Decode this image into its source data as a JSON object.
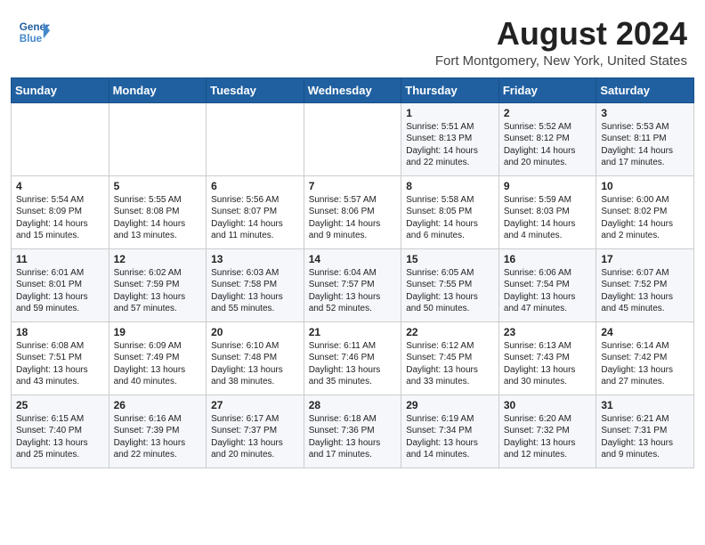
{
  "header": {
    "logo_line1": "General",
    "logo_line2": "Blue",
    "month_year": "August 2024",
    "location": "Fort Montgomery, New York, United States"
  },
  "weekdays": [
    "Sunday",
    "Monday",
    "Tuesday",
    "Wednesday",
    "Thursday",
    "Friday",
    "Saturday"
  ],
  "weeks": [
    [
      {
        "day": "",
        "info": ""
      },
      {
        "day": "",
        "info": ""
      },
      {
        "day": "",
        "info": ""
      },
      {
        "day": "",
        "info": ""
      },
      {
        "day": "1",
        "info": "Sunrise: 5:51 AM\nSunset: 8:13 PM\nDaylight: 14 hours\nand 22 minutes."
      },
      {
        "day": "2",
        "info": "Sunrise: 5:52 AM\nSunset: 8:12 PM\nDaylight: 14 hours\nand 20 minutes."
      },
      {
        "day": "3",
        "info": "Sunrise: 5:53 AM\nSunset: 8:11 PM\nDaylight: 14 hours\nand 17 minutes."
      }
    ],
    [
      {
        "day": "4",
        "info": "Sunrise: 5:54 AM\nSunset: 8:09 PM\nDaylight: 14 hours\nand 15 minutes."
      },
      {
        "day": "5",
        "info": "Sunrise: 5:55 AM\nSunset: 8:08 PM\nDaylight: 14 hours\nand 13 minutes."
      },
      {
        "day": "6",
        "info": "Sunrise: 5:56 AM\nSunset: 8:07 PM\nDaylight: 14 hours\nand 11 minutes."
      },
      {
        "day": "7",
        "info": "Sunrise: 5:57 AM\nSunset: 8:06 PM\nDaylight: 14 hours\nand 9 minutes."
      },
      {
        "day": "8",
        "info": "Sunrise: 5:58 AM\nSunset: 8:05 PM\nDaylight: 14 hours\nand 6 minutes."
      },
      {
        "day": "9",
        "info": "Sunrise: 5:59 AM\nSunset: 8:03 PM\nDaylight: 14 hours\nand 4 minutes."
      },
      {
        "day": "10",
        "info": "Sunrise: 6:00 AM\nSunset: 8:02 PM\nDaylight: 14 hours\nand 2 minutes."
      }
    ],
    [
      {
        "day": "11",
        "info": "Sunrise: 6:01 AM\nSunset: 8:01 PM\nDaylight: 13 hours\nand 59 minutes."
      },
      {
        "day": "12",
        "info": "Sunrise: 6:02 AM\nSunset: 7:59 PM\nDaylight: 13 hours\nand 57 minutes."
      },
      {
        "day": "13",
        "info": "Sunrise: 6:03 AM\nSunset: 7:58 PM\nDaylight: 13 hours\nand 55 minutes."
      },
      {
        "day": "14",
        "info": "Sunrise: 6:04 AM\nSunset: 7:57 PM\nDaylight: 13 hours\nand 52 minutes."
      },
      {
        "day": "15",
        "info": "Sunrise: 6:05 AM\nSunset: 7:55 PM\nDaylight: 13 hours\nand 50 minutes."
      },
      {
        "day": "16",
        "info": "Sunrise: 6:06 AM\nSunset: 7:54 PM\nDaylight: 13 hours\nand 47 minutes."
      },
      {
        "day": "17",
        "info": "Sunrise: 6:07 AM\nSunset: 7:52 PM\nDaylight: 13 hours\nand 45 minutes."
      }
    ],
    [
      {
        "day": "18",
        "info": "Sunrise: 6:08 AM\nSunset: 7:51 PM\nDaylight: 13 hours\nand 43 minutes."
      },
      {
        "day": "19",
        "info": "Sunrise: 6:09 AM\nSunset: 7:49 PM\nDaylight: 13 hours\nand 40 minutes."
      },
      {
        "day": "20",
        "info": "Sunrise: 6:10 AM\nSunset: 7:48 PM\nDaylight: 13 hours\nand 38 minutes."
      },
      {
        "day": "21",
        "info": "Sunrise: 6:11 AM\nSunset: 7:46 PM\nDaylight: 13 hours\nand 35 minutes."
      },
      {
        "day": "22",
        "info": "Sunrise: 6:12 AM\nSunset: 7:45 PM\nDaylight: 13 hours\nand 33 minutes."
      },
      {
        "day": "23",
        "info": "Sunrise: 6:13 AM\nSunset: 7:43 PM\nDaylight: 13 hours\nand 30 minutes."
      },
      {
        "day": "24",
        "info": "Sunrise: 6:14 AM\nSunset: 7:42 PM\nDaylight: 13 hours\nand 27 minutes."
      }
    ],
    [
      {
        "day": "25",
        "info": "Sunrise: 6:15 AM\nSunset: 7:40 PM\nDaylight: 13 hours\nand 25 minutes."
      },
      {
        "day": "26",
        "info": "Sunrise: 6:16 AM\nSunset: 7:39 PM\nDaylight: 13 hours\nand 22 minutes."
      },
      {
        "day": "27",
        "info": "Sunrise: 6:17 AM\nSunset: 7:37 PM\nDaylight: 13 hours\nand 20 minutes."
      },
      {
        "day": "28",
        "info": "Sunrise: 6:18 AM\nSunset: 7:36 PM\nDaylight: 13 hours\nand 17 minutes."
      },
      {
        "day": "29",
        "info": "Sunrise: 6:19 AM\nSunset: 7:34 PM\nDaylight: 13 hours\nand 14 minutes."
      },
      {
        "day": "30",
        "info": "Sunrise: 6:20 AM\nSunset: 7:32 PM\nDaylight: 13 hours\nand 12 minutes."
      },
      {
        "day": "31",
        "info": "Sunrise: 6:21 AM\nSunset: 7:31 PM\nDaylight: 13 hours\nand 9 minutes."
      }
    ]
  ]
}
